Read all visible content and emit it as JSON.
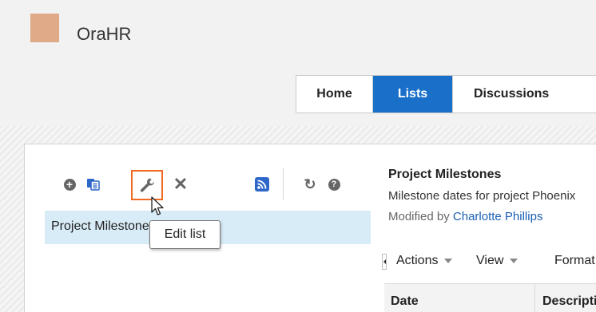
{
  "app": {
    "title": "OraHR"
  },
  "nav": {
    "tabs": [
      {
        "label": "Home"
      },
      {
        "label": "Lists"
      },
      {
        "label": "Discussions"
      }
    ],
    "active": "Lists"
  },
  "toolbar": {
    "icons": [
      "add-icon",
      "copy-icon",
      "wrench-icon",
      "delete-icon",
      "rss-icon",
      "refresh-icon",
      "help-icon"
    ],
    "add_symbol": "+",
    "delete_symbol": "✕",
    "refresh_symbol": "↻",
    "help_symbol": "?"
  },
  "list": {
    "selected_item": "Project Milestones"
  },
  "tooltip": {
    "text": "Edit list"
  },
  "detail": {
    "title": "Project Milestones",
    "description": "Milestone dates for project Phoenix",
    "modified_prefix": "Modified by",
    "modified_by": "Charlotte Phillips"
  },
  "menus": {
    "actions": "Actions",
    "view": "View",
    "format": "Format"
  },
  "table": {
    "columns": [
      "Date",
      "Description"
    ]
  },
  "colors": {
    "accent": "#1a6fc9",
    "highlight": "#f06a24",
    "selection": "#d8ecf7",
    "logo": "#e0a987"
  }
}
